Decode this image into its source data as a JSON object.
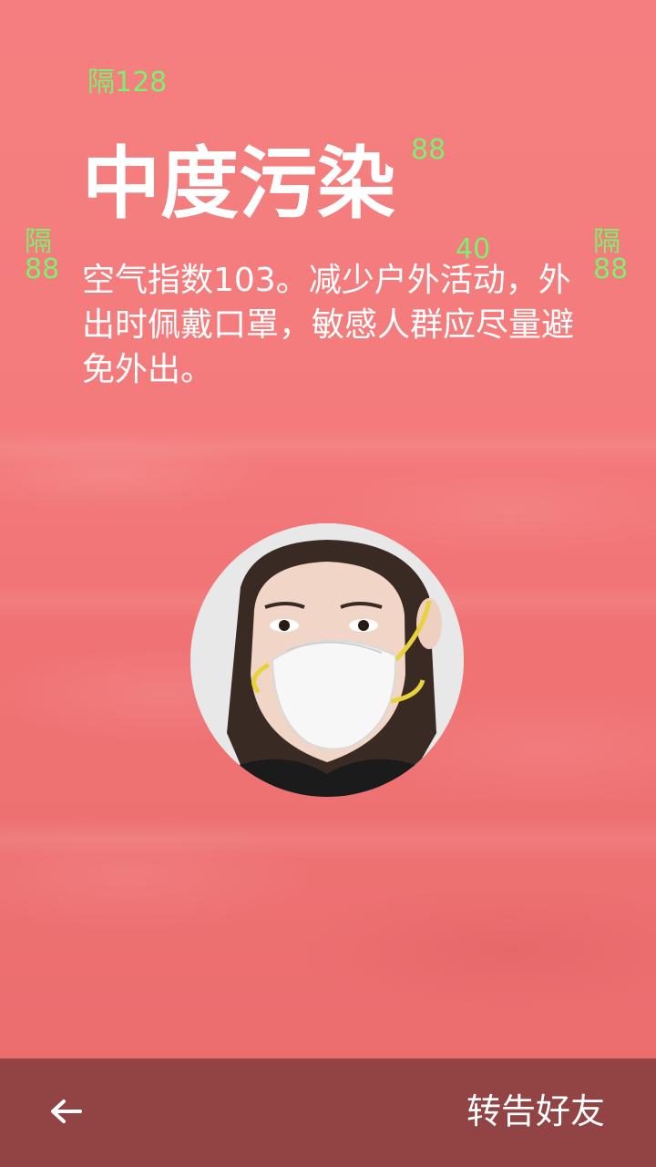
{
  "colors": {
    "background": "#f37a7b",
    "bottom_bar": "#924445",
    "text": "#ffffff",
    "annotation": "#7cf06f"
  },
  "annotations": {
    "top_spacing": "隔128",
    "title_right": "88",
    "left_margin": "隔\n88",
    "desc_top": "40",
    "right_margin": "隔\n88"
  },
  "pollution": {
    "level_title": "中度污染",
    "description": "空气指数103。减少户外活动，外出时佩戴口罩，敏感人群应尽量避免外出。"
  },
  "illustration": {
    "icon": "woman-wearing-mask-photo"
  },
  "bottom_bar": {
    "back_icon": "arrow-left-icon",
    "share_label": "转告好友"
  }
}
